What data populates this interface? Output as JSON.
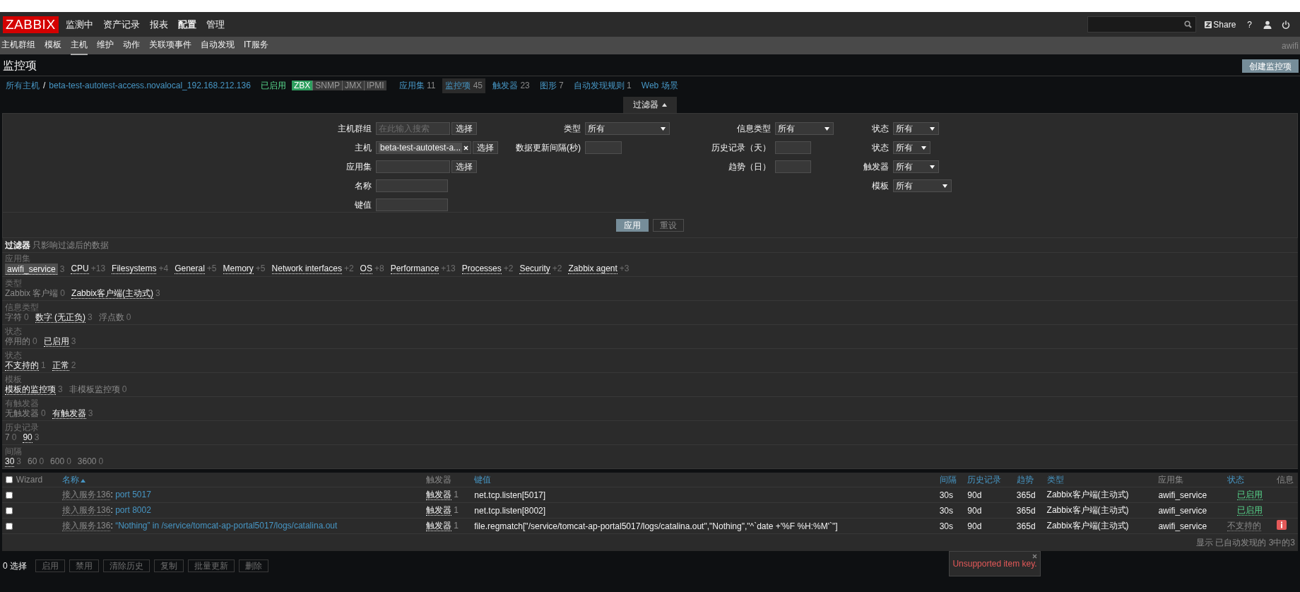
{
  "top_nav": {
    "logo": "ZABBIX",
    "items": [
      {
        "label": "监测中",
        "selected": false
      },
      {
        "label": "资产记录",
        "selected": false
      },
      {
        "label": "报表",
        "selected": false
      },
      {
        "label": "配置",
        "selected": true
      },
      {
        "label": "管理",
        "selected": false
      }
    ],
    "share": "Share",
    "help": "?"
  },
  "sub_nav": {
    "items": [
      {
        "label": "主机群组",
        "selected": false
      },
      {
        "label": "模板",
        "selected": false
      },
      {
        "label": "主机",
        "selected": true
      },
      {
        "label": "维护",
        "selected": false
      },
      {
        "label": "动作",
        "selected": false
      },
      {
        "label": "关联项事件",
        "selected": false
      },
      {
        "label": "自动发现",
        "selected": false
      },
      {
        "label": "IT服务",
        "selected": false
      }
    ],
    "user": "awifi"
  },
  "page": {
    "title": "监控项",
    "create_button": "创建监控项"
  },
  "breadcrumb": {
    "root": "所有主机",
    "separator": "/",
    "host": "beta-test-autotest-access.novalocal_192.168.212.136",
    "status": "已启用",
    "interfaces": [
      {
        "label": "ZBX",
        "available": true
      },
      {
        "label": "SNMP",
        "available": false
      },
      {
        "label": "JMX",
        "available": false
      },
      {
        "label": "IPMI",
        "available": false
      }
    ],
    "tabs": [
      {
        "label": "应用集",
        "count": "11",
        "selected": false
      },
      {
        "label": "监控项",
        "count": "45",
        "selected": true
      },
      {
        "label": "触发器",
        "count": "23",
        "selected": false
      },
      {
        "label": "图形",
        "count": "7",
        "selected": false
      },
      {
        "label": "自动发现规则",
        "count": "1",
        "selected": false
      },
      {
        "label": "Web 场景",
        "selected": false
      }
    ]
  },
  "filter": {
    "tab": "过滤器",
    "expanded": true,
    "columns": [
      [
        {
          "label": "主机群组",
          "kind": "multiselect",
          "placeholder": "在此输入搜索",
          "button": "选择"
        },
        {
          "label": "主机",
          "kind": "multiselect",
          "value": "beta-test-autotest-a...",
          "button": "选择"
        },
        {
          "label": "应用集",
          "kind": "multiselect",
          "button": "选择"
        },
        {
          "label": "名称",
          "kind": "text"
        },
        {
          "label": "键值",
          "kind": "text"
        }
      ],
      [
        {
          "label": "类型",
          "kind": "select",
          "value": "所有"
        },
        {
          "label": "数据更新间隔(秒)",
          "kind": "text"
        }
      ],
      [
        {
          "label": "信息类型",
          "kind": "select",
          "value": "所有"
        },
        {
          "label": "历史记录（天）",
          "kind": "text"
        },
        {
          "label": "趋势（日）",
          "kind": "text"
        }
      ],
      [
        {
          "label": "状态",
          "kind": "select",
          "value": "所有"
        },
        {
          "label": "状态",
          "kind": "select",
          "value": "所有"
        },
        {
          "label": "触发器",
          "kind": "select",
          "value": "所有"
        },
        {
          "label": "模板",
          "kind": "select",
          "value": "所有"
        }
      ]
    ],
    "apply": "应用",
    "reset": "重设"
  },
  "subfilter": {
    "title": "过滤器",
    "note": "只影响过滤后的数据",
    "groups": [
      {
        "label": "应用集",
        "options": [
          {
            "name": "awifi_service",
            "count": "3",
            "selected": true,
            "disabled": false
          },
          {
            "name": "CPU",
            "count": "+13",
            "selected": false,
            "disabled": false
          },
          {
            "name": "Filesystems",
            "count": "+4",
            "selected": false,
            "disabled": false
          },
          {
            "name": "General",
            "count": "+5",
            "selected": false,
            "disabled": false
          },
          {
            "name": "Memory",
            "count": "+5",
            "selected": false,
            "disabled": false
          },
          {
            "name": "Network interfaces",
            "count": "+2",
            "selected": false,
            "disabled": false
          },
          {
            "name": "OS",
            "count": "+8",
            "selected": false,
            "disabled": false
          },
          {
            "name": "Performance",
            "count": "+13",
            "selected": false,
            "disabled": false
          },
          {
            "name": "Processes",
            "count": "+2",
            "selected": false,
            "disabled": false
          },
          {
            "name": "Security",
            "count": "+2",
            "selected": false,
            "disabled": false
          },
          {
            "name": "Zabbix agent",
            "count": "+3",
            "selected": false,
            "disabled": false
          }
        ]
      },
      {
        "label": "类型",
        "options": [
          {
            "name": "Zabbix 客户端",
            "count": "0",
            "selected": false,
            "disabled": true
          },
          {
            "name": "Zabbix客户端(主动式)",
            "count": "3",
            "selected": false,
            "disabled": false
          }
        ]
      },
      {
        "label": "信息类型",
        "options": [
          {
            "name": "字符",
            "count": "0",
            "selected": false,
            "disabled": true
          },
          {
            "name": "数字 (无正负)",
            "count": "3",
            "selected": false,
            "disabled": false
          },
          {
            "name": "浮点数",
            "count": "0",
            "selected": false,
            "disabled": true
          }
        ]
      },
      {
        "label": "状态",
        "options": [
          {
            "name": "停用的",
            "count": "0",
            "selected": false,
            "disabled": true
          },
          {
            "name": "已启用",
            "count": "3",
            "selected": false,
            "disabled": false
          }
        ]
      },
      {
        "label": "状态",
        "options": [
          {
            "name": "不支持的",
            "count": "1",
            "selected": false,
            "disabled": false
          },
          {
            "name": "正常",
            "count": "2",
            "selected": false,
            "disabled": false
          }
        ]
      },
      {
        "label": "模板",
        "options": [
          {
            "name": "模板的监控项",
            "count": "3",
            "selected": false,
            "disabled": false
          },
          {
            "name": "非模板监控项",
            "count": "0",
            "selected": false,
            "disabled": true
          }
        ]
      },
      {
        "label": "有触发器",
        "options": [
          {
            "name": "无触发器",
            "count": "0",
            "selected": false,
            "disabled": true
          },
          {
            "name": "有触发器",
            "count": "3",
            "selected": false,
            "disabled": false
          }
        ]
      },
      {
        "label": "历史记录",
        "options": [
          {
            "name": "7",
            "count": "0",
            "selected": false,
            "disabled": true
          },
          {
            "name": "90",
            "count": "3",
            "selected": false,
            "disabled": false
          }
        ]
      },
      {
        "label": "间隔",
        "options": [
          {
            "name": "30",
            "count": "3",
            "selected": false,
            "disabled": false
          },
          {
            "name": "60",
            "count": "0",
            "selected": false,
            "disabled": true
          },
          {
            "name": "600",
            "count": "0",
            "selected": false,
            "disabled": true
          },
          {
            "name": "3600",
            "count": "0",
            "selected": false,
            "disabled": true
          }
        ]
      }
    ]
  },
  "table": {
    "all_checked": false,
    "columns": [
      {
        "label": "Wizard",
        "sortable": false
      },
      {
        "label": "名称",
        "sortable": true,
        "sorted": true
      },
      {
        "label": "触发器",
        "sortable": false
      },
      {
        "label": "键值",
        "sortable": true
      },
      {
        "label": "间隔",
        "sortable": true
      },
      {
        "label": "历史记录",
        "sortable": true
      },
      {
        "label": "趋势",
        "sortable": true
      },
      {
        "label": "类型",
        "sortable": true
      },
      {
        "label": "应用集",
        "sortable": false
      },
      {
        "label": "状态",
        "sortable": true
      },
      {
        "label": "信息",
        "sortable": false
      }
    ],
    "rows": [
      {
        "checked": false,
        "template": "接入服务136",
        "separator": ":",
        "name": "port 5017",
        "triggers": "触发器",
        "trigger_count": "1",
        "key": "net.tcp.listen[5017]",
        "interval": "30s",
        "history": "90d",
        "trends": "365d",
        "type": "Zabbix客户端(主动式)",
        "applications": "awifi_service",
        "status": "已启用",
        "supported": true,
        "error": false
      },
      {
        "checked": false,
        "template": "接入服务136",
        "separator": ":",
        "name": "port 8002",
        "triggers": "触发器",
        "trigger_count": "1",
        "key": "net.tcp.listen[8002]",
        "interval": "30s",
        "history": "90d",
        "trends": "365d",
        "type": "Zabbix客户端(主动式)",
        "applications": "awifi_service",
        "status": "已启用",
        "supported": true,
        "error": false
      },
      {
        "checked": false,
        "template": "接入服务136",
        "separator": ":",
        "name": "“Nothing” in /service/tomcat-ap-portal5017/logs/catalina.out",
        "triggers": "触发器",
        "trigger_count": "1",
        "key": "file.regmatch[\"/service/tomcat-ap-portal5017/logs/catalina.out\",\"Nothing\",\"^`date +'%F %H:%M'`\"]",
        "interval": "30s",
        "history": "90d",
        "trends": "365d",
        "type": "Zabbix客户端(主动式)",
        "applications": "awifi_service",
        "status": "不支持的",
        "supported": false,
        "error": true
      }
    ],
    "footer": "显示 已自动发现的 3中的3"
  },
  "actions": {
    "selected": "0 选择",
    "buttons": [
      "启用",
      "禁用",
      "清除历史",
      "复制",
      "批量更新",
      "删除"
    ]
  },
  "tooltip": {
    "text": "Unsupported item key."
  }
}
